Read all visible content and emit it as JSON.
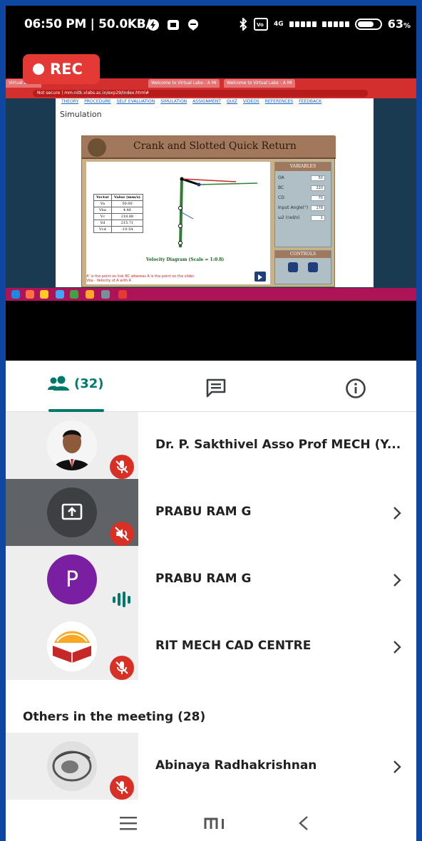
{
  "status_bar": {
    "time": "06:50 PM",
    "speed": "50.0KB/s",
    "network_label": "4G",
    "battery": "63"
  },
  "recording": {
    "label": "REC"
  },
  "shared_screen": {
    "tabs": [
      "Virtual Lab",
      "Welcome to Virtual Labs - A MI",
      "Welcome to Virtual Labs - A MI"
    ],
    "url": "Not secure | mm-nitk.vlabs.ac.in/exp29/index.html#",
    "nav_links": [
      "THEORY",
      "PROCEDURE",
      "SELF EVALUATION",
      "SIMULATION",
      "ASSIGNMENT",
      "QUIZ",
      "VIDEOS",
      "REFERENCES",
      "FEEDBACK"
    ],
    "section_label": "Simulation",
    "sim_title": "Crank and Slotted Quick Return",
    "variables_title": "VARIABLES",
    "controls_title": "CONTROLS",
    "variables": [
      {
        "label": "OA",
        "value": "50"
      },
      {
        "label": "BC",
        "value": "220"
      },
      {
        "label": "CD",
        "value": "70"
      },
      {
        "label": "Input Angle(°)",
        "value": "178"
      },
      {
        "label": "ω2 (rad/s)",
        "value": "1"
      }
    ],
    "velocity_table": {
      "headers": [
        "Vector",
        "Value (mm/s)"
      ],
      "rows": [
        [
          "Va",
          "50.00"
        ],
        [
          "Vba",
          "4.46"
        ],
        [
          "Vc",
          "218.88"
        ],
        [
          "Vd",
          "215.71"
        ],
        [
          "Vcd",
          "-10.54"
        ]
      ]
    },
    "diagram_label": "Velocity Diagram (Scale = 1:0.8)",
    "note": "A' is the point on link BC whereas A is the point on the slider. Vba - Velocity of A with A"
  },
  "tabs": {
    "people_count": "(32)"
  },
  "participants": [
    {
      "name": "Dr. P. Sakthivel Asso Prof MECH (Y...",
      "muted": true,
      "active": false,
      "avatar": "photo"
    },
    {
      "name": "PRABU RAM G",
      "muted": true,
      "active": true,
      "avatar": "present-icon"
    },
    {
      "name": "PRABU RAM G",
      "muted": false,
      "active": false,
      "avatar": "initial",
      "initial": "P"
    },
    {
      "name": "RIT MECH CAD CENTRE",
      "muted": true,
      "active": false,
      "avatar": "logo"
    }
  ],
  "others_heading": "Others in the meeting (28)",
  "others": [
    {
      "name": "Abinaya Radhakrishnan",
      "muted": true,
      "avatar": "sketch"
    }
  ],
  "colors": {
    "accent": "#00796b",
    "mute": "#d93025",
    "rec": "#e53935",
    "initial_avatar": "#7b1fa2",
    "active_row": "#5f6368"
  }
}
